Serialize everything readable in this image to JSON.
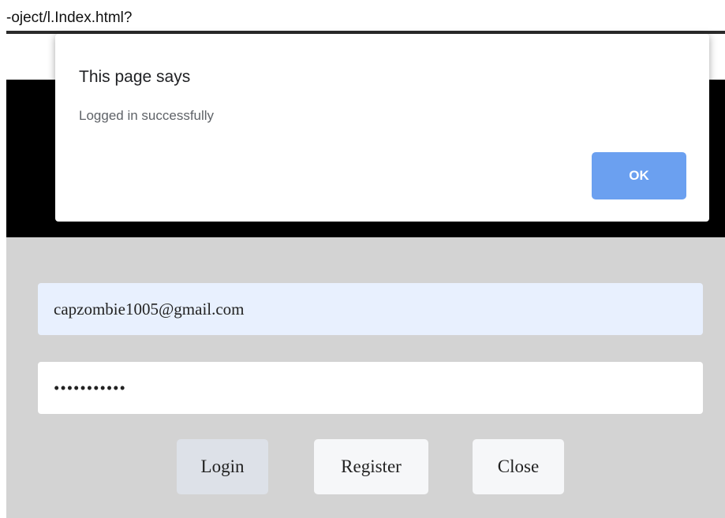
{
  "browser": {
    "url_fragment": "-oject/l.Index.html?"
  },
  "dialog": {
    "title": "This page says",
    "message": "Logged in successfully",
    "ok_label": "OK",
    "ok_color": "#6ba0f0"
  },
  "form": {
    "email_value": "capzombie1005@gmail.com",
    "password_value": "xxxxxxxxxxx",
    "login_label": "Login",
    "register_label": "Register",
    "close_label": "Close"
  },
  "colors": {
    "header_band": "#000000",
    "form_background": "#d3d3d3",
    "autofill_background": "#e8f0fe"
  }
}
